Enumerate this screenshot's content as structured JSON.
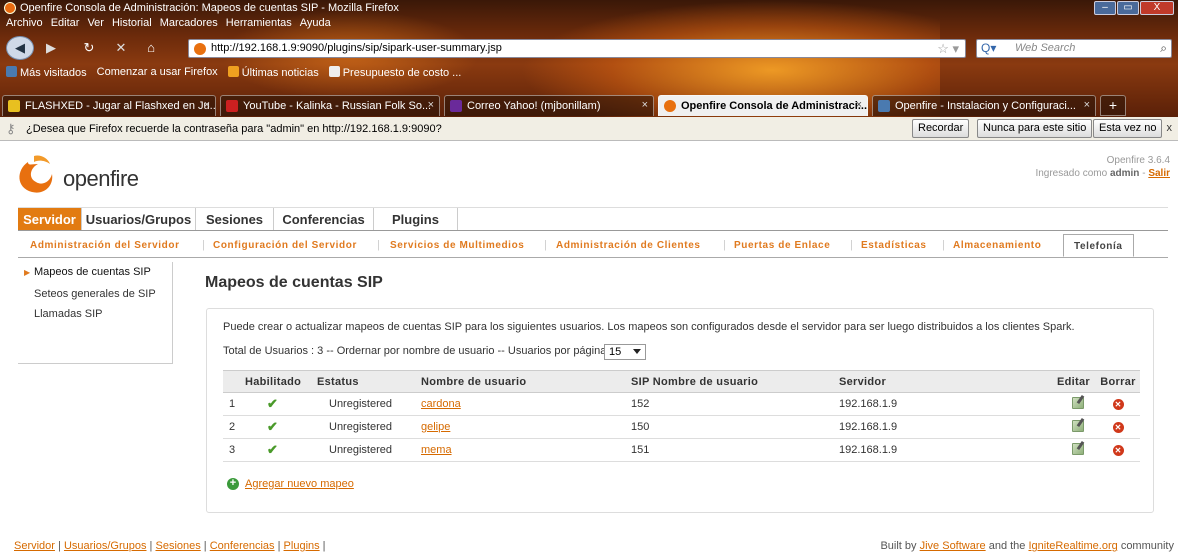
{
  "browser": {
    "window_title": "Openfire Consola de Administración: Mapeos de cuentas SIP - Mozilla Firefox",
    "window_controls": [
      "–",
      "▭",
      "X"
    ],
    "menu": [
      "Archivo",
      "Editar",
      "Ver",
      "Historial",
      "Marcadores",
      "Herramientas",
      "Ayuda"
    ],
    "url": "http://192.168.1.9:9090/plugins/sip/sipark-user-summary.jsp",
    "search_placeholder": "Web Search",
    "bookmarks": [
      "Más visitados",
      "Comenzar a usar Firefox",
      "Últimas noticias",
      "Presupuesto de costo ..."
    ],
    "tabs": [
      {
        "label": "FLASHXED - Jugar al Flashxed en Ju...",
        "icon_color": "#e8c020"
      },
      {
        "label": "YouTube - Kalinka - Russian Folk So...",
        "icon_color": "#cc2020"
      },
      {
        "label": "Correo Yahoo! (mjbonillam)",
        "icon_color": "#6a2a9a"
      },
      {
        "label": "Openfire Consola de Administraci...",
        "icon_color": "#e8700f",
        "active": true
      },
      {
        "label": "Openfire - Instalacion y Configuraci...",
        "icon_color": "#4a7ab0"
      }
    ],
    "notification": {
      "message": "¿Desea que Firefox recuerde la contraseña para \"admin\" en http://192.168.1.9:9090?",
      "remember": "Recordar",
      "never": "Nunca para este sitio",
      "not_now": "Esta vez no",
      "close": "x"
    }
  },
  "header": {
    "logo_text": "openfire",
    "version": "Openfire 3.6.4",
    "logged_prefix": "Ingresado como",
    "logged_user": "admin",
    "separator": "-",
    "logout": "Salir"
  },
  "main_nav": [
    "Servidor",
    "Usuarios/Grupos",
    "Sesiones",
    "Conferencias",
    "Plugins"
  ],
  "sub_nav": [
    "Administración del Servidor",
    "Configuración del Servidor",
    "Servicios de Multimedios",
    "Administración de Clientes",
    "Puertas de Enlace",
    "Estadísticas",
    "Almacenamiento",
    "Telefonía"
  ],
  "sidebar": [
    "Mapeos de cuentas SIP",
    "Seteos generales de SIP",
    "Llamadas SIP"
  ],
  "page": {
    "title": "Mapeos de cuentas SIP",
    "description": "Puede crear o actualizar mapeos de cuentas SIP para los siguientes usuarios. Los mapeos son configurados desde el servidor para ser luego distribuidos a los clientes Spark.",
    "totals": "Total de Usuarios : 3 -- Ordernar por nombre de usuario -- Usuarios por página :",
    "per_page": "15",
    "columns": [
      "Habilitado",
      "Estatus",
      "Nombre de usuario",
      "SIP Nombre de usuario",
      "Servidor",
      "Editar",
      "Borrar"
    ],
    "rows": [
      {
        "n": "1",
        "enabled": "✔",
        "status": "Unregistered",
        "user": "cardona",
        "sip_user": "152",
        "server": "192.168.1.9"
      },
      {
        "n": "2",
        "enabled": "✔",
        "status": "Unregistered",
        "user": "gelipe",
        "sip_user": "150",
        "server": "192.168.1.9"
      },
      {
        "n": "3",
        "enabled": "✔",
        "status": "Unregistered",
        "user": "mema",
        "sip_user": "151",
        "server": "192.168.1.9"
      }
    ],
    "add_link": "Agregar nuevo mapeo"
  },
  "footer": {
    "links": [
      "Servidor",
      "Usuarios/Grupos",
      "Sesiones",
      "Conferencias",
      "Plugins"
    ],
    "built_by": "Built by",
    "jive": "Jive Software",
    "and_the": "and the",
    "ignite": "IgniteRealtime.org",
    "community": "community"
  },
  "colors": {
    "accent": "#e27b11",
    "link": "#d66a00",
    "check": "#4a9a2a",
    "delete": "#d0381a"
  }
}
